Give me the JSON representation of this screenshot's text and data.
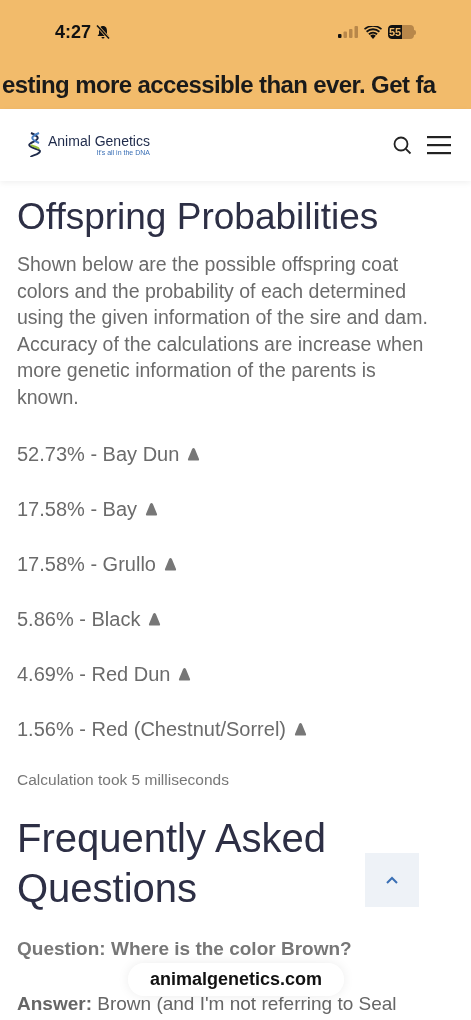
{
  "status_bar": {
    "time": "4:27",
    "battery": "55"
  },
  "banner": {
    "text": "esting more accessible than ever. Get fa"
  },
  "header": {
    "logo_title": "Animal Genetics",
    "logo_tagline": "It's all in the DNA"
  },
  "title": "Offspring Probabilities",
  "intro": "Shown below are the possible offspring coat colors and the probability of each determined using the given information of the sire and dam. Accuracy of the calculations are increase when more genetic information of the parents is known.",
  "results": [
    {
      "text": "52.73% - Bay Dun"
    },
    {
      "text": "17.58% - Bay"
    },
    {
      "text": "17.58% - Grullo"
    },
    {
      "text": "5.86% - Black"
    },
    {
      "text": "4.69% - Red Dun"
    },
    {
      "text": "1.56% - Red (Chestnut/Sorrel)"
    }
  ],
  "timing": "Calculation took 5 milliseconds",
  "faq": {
    "heading": "Frequently Asked Questions",
    "question": "Question: Where is the color Brown?",
    "answer": "**Answer:** Brown (and I'm not referring to Seal"
  },
  "url_pill": "animalgenetics.com"
}
